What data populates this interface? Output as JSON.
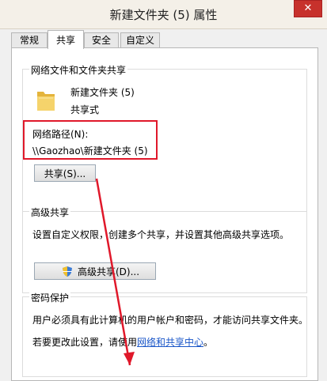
{
  "window": {
    "title": "新建文件夹 (5) 属性",
    "close_glyph": "✕"
  },
  "tabs": [
    {
      "label": "常规",
      "active": false
    },
    {
      "label": "共享",
      "active": true
    },
    {
      "label": "安全",
      "active": false
    },
    {
      "label": "自定义",
      "active": false
    }
  ],
  "network_share": {
    "group_title": "网络文件和文件夹共享",
    "folder_name": "新建文件夹 (5)",
    "share_state": "共享式",
    "path_label": "网络路径(N):",
    "path_value": "\\\\Gaozhao\\新建文件夹 (5)",
    "share_button": "共享(S)..."
  },
  "advanced_share": {
    "group_title": "高级共享",
    "description": "设置自定义权限，创建多个共享，并设置其他高级共享选项。",
    "button": "高级共享(D)..."
  },
  "password_protect": {
    "group_title": "密码保护",
    "description": "用户必须具有此计算机的用户帐户和密码，才能访问共享文件夹。",
    "change_text": "若要更改此设置，请使用",
    "link_text": "网络和共享中心",
    "suffix": "。"
  },
  "colors": {
    "highlight": "#e0182a",
    "link": "#1a56c8",
    "close": "#c7312c"
  }
}
